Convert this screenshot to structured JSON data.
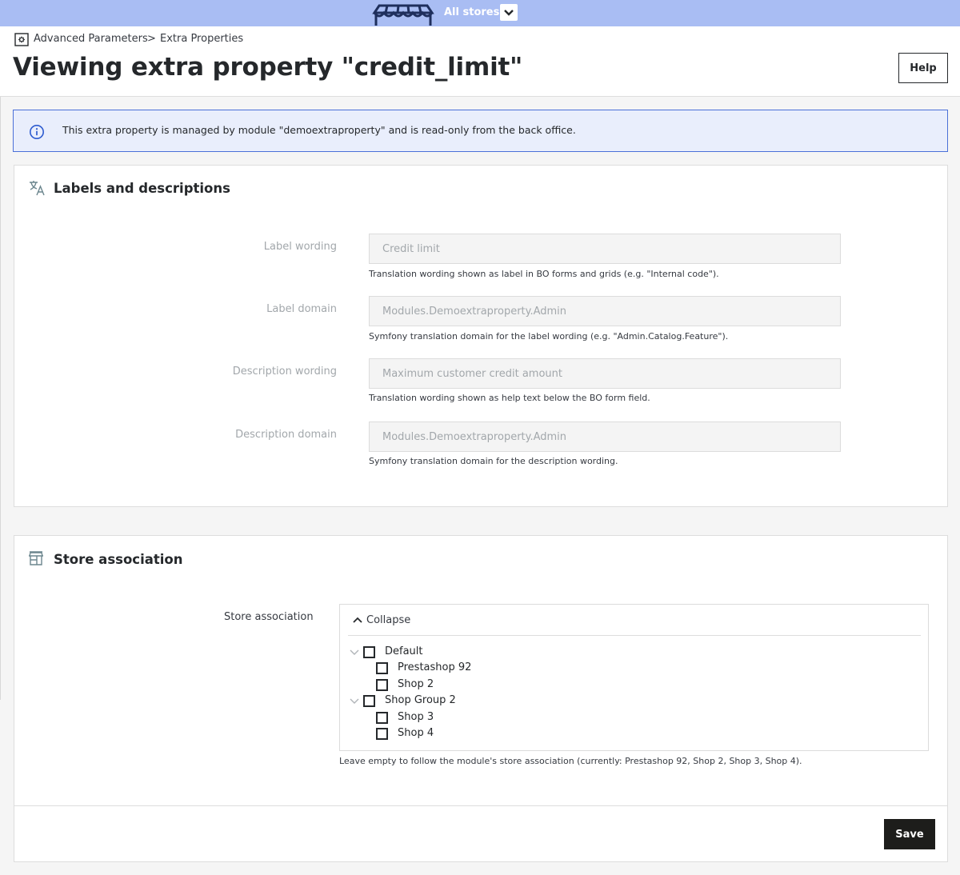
{
  "topbar": {
    "store_label": "All stores",
    "store_icon": "storefront-icon",
    "dropdown_icon": "chevron-down-icon"
  },
  "breadcrumb": {
    "items": [
      "Advanced Parameters",
      "Extra Properties"
    ],
    "separator": ">",
    "icon": "gear-square-icon"
  },
  "page": {
    "title": "Viewing extra property \"credit_limit\"",
    "help_label": "Help"
  },
  "alert": {
    "icon": "info-circle-icon",
    "text": "This extra property is managed by module \"demoextraproperty\" and is read-only from the back office."
  },
  "labels_card": {
    "title": "Labels and descriptions",
    "icon": "translate-icon",
    "fields": [
      {
        "label": "Label wording",
        "value": "Credit limit",
        "help": "Translation wording shown as label in BO forms and grids (e.g. \"Internal code\")."
      },
      {
        "label": "Label domain",
        "value": "Modules.Demoextraproperty.Admin",
        "help": "Symfony translation domain for the label wording (e.g. \"Admin.Catalog.Feature\")."
      },
      {
        "label": "Description wording",
        "value": "Maximum customer credit amount",
        "help": "Translation wording shown as help text below the BO form field."
      },
      {
        "label": "Description domain",
        "value": "Modules.Demoextraproperty.Admin",
        "help": "Symfony translation domain for the description wording."
      }
    ]
  },
  "store_card": {
    "title": "Store association",
    "icon": "store-icon",
    "field_label": "Store association",
    "collapse_label": "Collapse",
    "tree": [
      {
        "label": "Default",
        "checked": false,
        "shops": [
          {
            "label": "Prestashop 92",
            "checked": false
          },
          {
            "label": "Shop 2",
            "checked": false
          }
        ]
      },
      {
        "label": "Shop Group 2",
        "checked": false,
        "shops": [
          {
            "label": "Shop 3",
            "checked": false
          },
          {
            "label": "Shop 4",
            "checked": false
          }
        ]
      }
    ],
    "help": "Leave empty to follow the module's store association (currently: Prestashop 92, Shop 2, Shop 3, Shop 4).",
    "save_label": "Save"
  },
  "colors": {
    "topbar": "#a9bdf3",
    "alert_bg": "#e9eefc",
    "alert_border": "#4a70d8",
    "save_bg": "#1d1d1b"
  }
}
